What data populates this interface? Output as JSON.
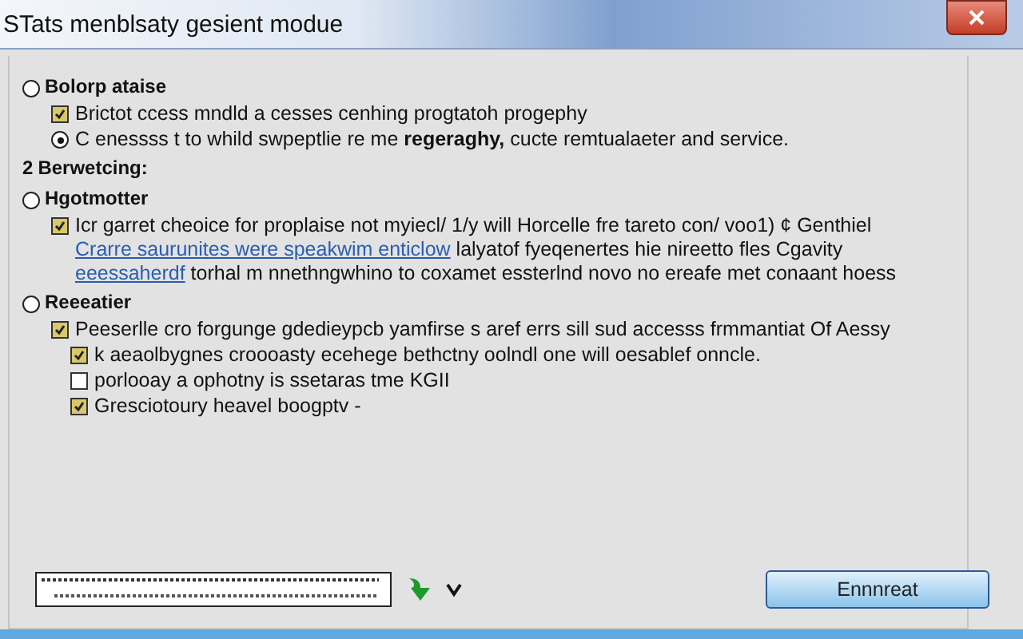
{
  "window": {
    "title": "STats menblsaty gesient modue"
  },
  "sections": [
    {
      "kind": "radio",
      "label": "Bolorp ataise",
      "selected": false,
      "items": [
        {
          "kind": "checkbox",
          "checked": true,
          "parts": [
            {
              "text": "Brictot ccess mndld a cesses cenhing progtatoh progephy",
              "link": false
            }
          ]
        },
        {
          "kind": "radio",
          "selected": true,
          "parts": [
            {
              "text": "C enessss t to whild swpeptlie re me **regeraghy,** cucte remtualaeter and service.",
              "link": false
            }
          ]
        }
      ]
    },
    {
      "kind": "number",
      "mark": "2",
      "label": "Berwetcing:"
    },
    {
      "kind": "radio",
      "label": "Hgotmotter",
      "selected": false,
      "items": [
        {
          "kind": "checkbox",
          "checked": true,
          "parts": [
            {
              "text": "Icr garret cheoice for proplaise not myiecl/ 1/y will Horcelle fre tareto con/ voo1) ¢ Genthiel ",
              "link": false
            },
            {
              "text": "Crarre saurunites were speakwim enticlow",
              "link": true
            },
            {
              "text": " lalyatof fyeqenertes hie nireetto fles Cgavity ",
              "link": false
            },
            {
              "text": "eeessaherdf",
              "link": true
            },
            {
              "text": " torhal m nnethngwhino to coxamet essterlnd novo no ereafe met conaant hoess",
              "link": false
            }
          ]
        }
      ]
    },
    {
      "kind": "radio",
      "label": "Reeeatier",
      "selected": false,
      "items": [
        {
          "kind": "checkbox",
          "checked": true,
          "parts": [
            {
              "text": "Peeserlle cro forgunge gdedieypcb yamfirse s aref errs sill sud accesss frmmantiat Of Aessy",
              "link": false
            }
          ],
          "children": [
            {
              "kind": "checkbox",
              "checked": true,
              "parts": [
                {
                  "text": "k aeaolbygnes croooasty ecehege bethctny oolndl one will oesablef onncle.",
                  "link": false
                }
              ]
            },
            {
              "kind": "checkbox",
              "checked": false,
              "parts": [
                {
                  "text": "porlooay a ophotny is ssetaras tme KGII",
                  "link": false
                }
              ]
            },
            {
              "kind": "checkbox",
              "checked": true,
              "parts": [
                {
                  "text": "Gresciotoury heavel boogptv -",
                  "link": false
                }
              ]
            }
          ]
        }
      ]
    }
  ],
  "button": "Ennnreat"
}
